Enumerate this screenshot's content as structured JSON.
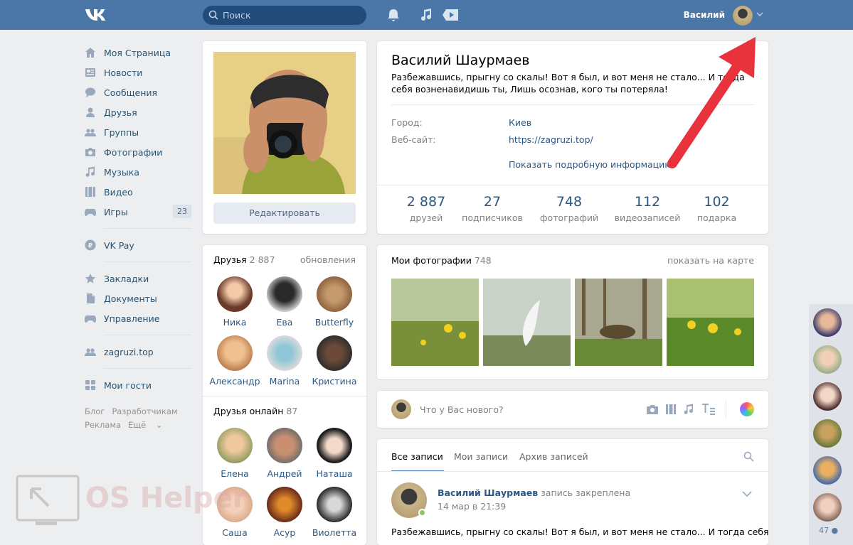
{
  "header": {
    "search_placeholder": "Поиск",
    "user_name": "Василий"
  },
  "sidebar": {
    "items": [
      {
        "label": "Моя Страница",
        "icon": "home-icon"
      },
      {
        "label": "Новости",
        "icon": "news-icon"
      },
      {
        "label": "Сообщения",
        "icon": "messages-icon"
      },
      {
        "label": "Друзья",
        "icon": "friends-icon"
      },
      {
        "label": "Группы",
        "icon": "groups-icon"
      },
      {
        "label": "Фотографии",
        "icon": "camera-icon"
      },
      {
        "label": "Музыка",
        "icon": "music-icon"
      },
      {
        "label": "Видео",
        "icon": "video-icon"
      },
      {
        "label": "Игры",
        "icon": "games-icon",
        "badge": "23"
      },
      {
        "label": "VK Pay",
        "icon": "vkpay-icon"
      },
      {
        "label": "Закладки",
        "icon": "star-icon"
      },
      {
        "label": "Документы",
        "icon": "document-icon"
      },
      {
        "label": "Управление",
        "icon": "gamepad-icon"
      },
      {
        "label": "zagruzi.top",
        "icon": "group-icon"
      },
      {
        "label": "Мои гости",
        "icon": "apps-icon"
      }
    ],
    "footer": [
      "Блог",
      "Разработчикам",
      "Реклама",
      "Ещё"
    ]
  },
  "profile": {
    "edit_button": "Редактировать",
    "name": "Василий Шаурмаев",
    "status": "Разбежавшись, прыгну со скалы! Вот я был, и вот меня не стало... И тогда себя возненавидишь ты, Лишь осознав, кого ты потеряла!",
    "city_label": "Город:",
    "city_value": "Киев",
    "site_label": "Веб-сайт:",
    "site_value": "https://zagruzi.top/",
    "more_info": "Показать подробную информацию",
    "stats": [
      {
        "n": "2 887",
        "l": "друзей"
      },
      {
        "n": "27",
        "l": "подписчиков"
      },
      {
        "n": "748",
        "l": "фотографий"
      },
      {
        "n": "112",
        "l": "видеозаписей"
      },
      {
        "n": "102",
        "l": "подарка"
      }
    ]
  },
  "friends": {
    "title": "Друзья",
    "count": "2 887",
    "updates": "обновления",
    "list": [
      "Ника",
      "Ева",
      "Butterfly",
      "Александр",
      "Marina",
      "Кристина"
    ]
  },
  "friends_online": {
    "title": "Друзья онлайн",
    "count": "87",
    "list": [
      "Елена",
      "Андрей",
      "Наташа",
      "Саша",
      "Асур",
      "Виолетта"
    ]
  },
  "photos": {
    "title": "Мои фотографии",
    "count": "748",
    "map_link": "показать на карте"
  },
  "composer": {
    "placeholder": "Что у Вас нового?"
  },
  "wall": {
    "tabs": [
      "Все записи",
      "Мои записи",
      "Архив записей"
    ],
    "post_author": "Василий Шаурмаев",
    "post_pinned": "запись закреплена",
    "post_date": "14 мар в 21:39",
    "post_text": "Разбежавшись, прыгну со скалы! Вот я был, и вот меня не стало... И тогда себя"
  },
  "online_bar": {
    "count": "47"
  },
  "watermark": {
    "text": "OS Helper"
  }
}
